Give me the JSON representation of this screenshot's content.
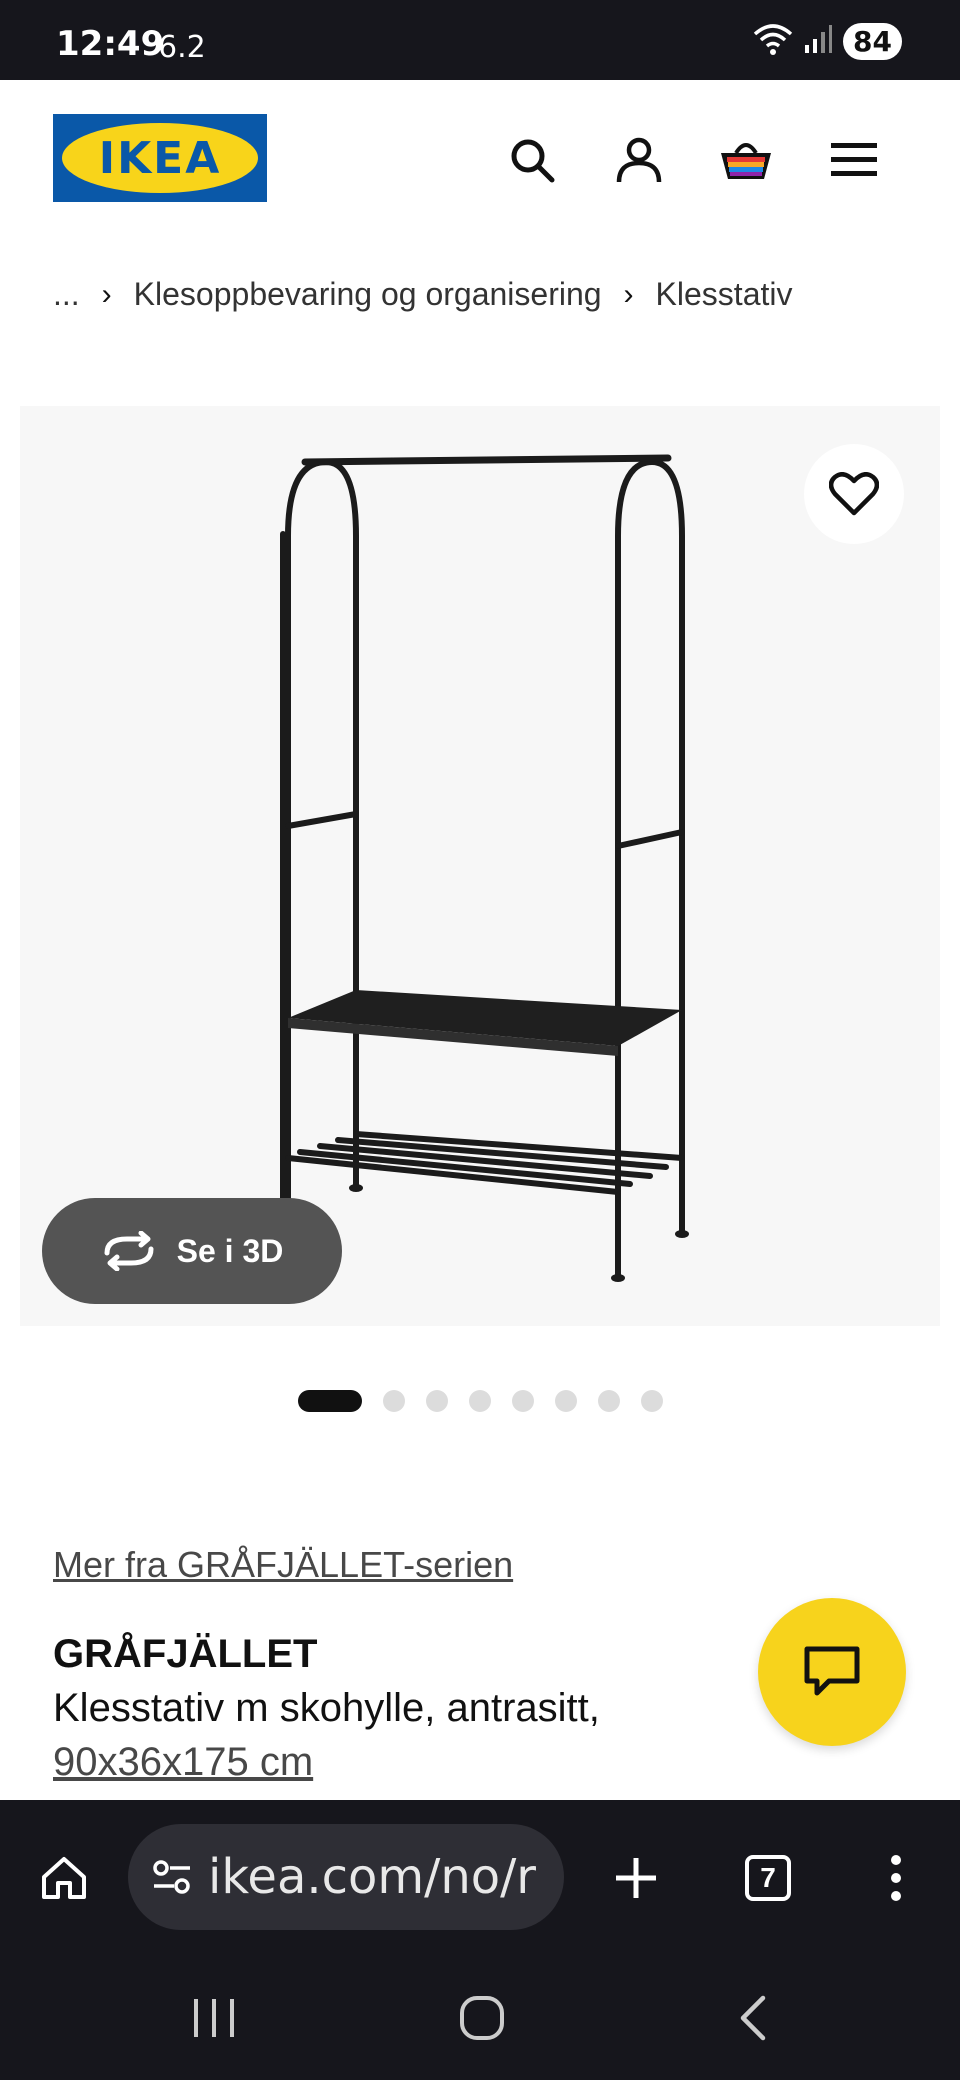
{
  "status_bar": {
    "time": "12:49",
    "speed": "6.2",
    "battery": "84",
    "icons": [
      "wifi-icon",
      "signal-icon",
      "battery-icon"
    ]
  },
  "header": {
    "logo_text": "IKEA",
    "icons": [
      "search-icon",
      "account-icon",
      "cart-icon",
      "menu-icon"
    ]
  },
  "breadcrumb": {
    "items": [
      "...",
      "Klesoppbevaring og organisering",
      "Klesstativ"
    ]
  },
  "gallery": {
    "view3d_label": "Se i 3D",
    "page_count": 8,
    "active_page": 1
  },
  "product": {
    "series_link": "Mer fra GRÅFJÄLLET-serien",
    "name": "GRÅFJÄLLET",
    "description": "Klesstativ m skohylle, antrasitt,",
    "size": "90x36x175 cm"
  },
  "browser": {
    "url": "ikea.com/no/r",
    "tab_count": "7"
  },
  "colors": {
    "ikea_blue": "#0a58a8",
    "ikea_yellow": "#f8d41a",
    "chat_yellow": "#f7d31c",
    "system_bar": "#16161c"
  }
}
